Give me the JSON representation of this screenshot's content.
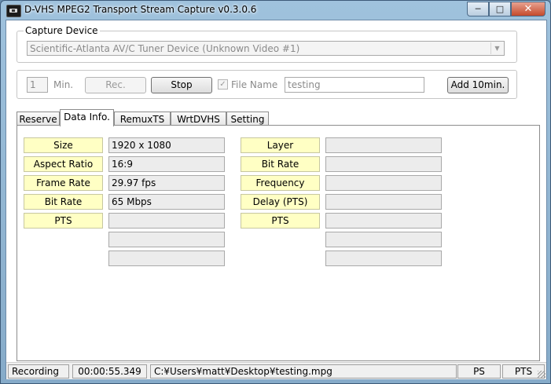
{
  "window": {
    "title": "D-VHS MPEG2 Transport Stream Capture v0.3.0.6"
  },
  "capture_device": {
    "group_label": "Capture Device",
    "selected": "Scientific-Atlanta AV/C Tuner Device (Unknown Video #1)"
  },
  "controls": {
    "minutes_value": "1",
    "minutes_label": "Min.",
    "rec_label": "Rec.",
    "stop_label": "Stop",
    "file_name_checked": true,
    "file_name_label": "File Name",
    "file_name_value": "testing",
    "add_label": "Add 10min."
  },
  "tabs": [
    {
      "label": "Reserve",
      "active": false
    },
    {
      "label": "Data Info.",
      "active": true
    },
    {
      "label": "RemuxTS",
      "active": false
    },
    {
      "label": "WrtDVHS",
      "active": false
    },
    {
      "label": "Setting",
      "active": false
    }
  ],
  "video_info": {
    "rows": [
      {
        "label": "Size",
        "value": "1920 x 1080"
      },
      {
        "label": "Aspect Ratio",
        "value": "16:9"
      },
      {
        "label": "Frame Rate",
        "value": "29.97 fps"
      },
      {
        "label": "Bit Rate",
        "value": "65 Mbps"
      },
      {
        "label": "PTS",
        "value": ""
      }
    ],
    "extra": [
      "",
      ""
    ]
  },
  "audio_info": {
    "rows": [
      {
        "label": "Layer",
        "value": ""
      },
      {
        "label": "Bit Rate",
        "value": ""
      },
      {
        "label": "Frequency",
        "value": ""
      },
      {
        "label": "Delay (PTS)",
        "value": ""
      },
      {
        "label": "PTS",
        "value": ""
      }
    ],
    "extra": [
      "",
      ""
    ]
  },
  "status": {
    "state": "Recording",
    "elapsed": "00:00:55.349",
    "path": "C:¥Users¥matt¥Desktop¥testing.mpg",
    "ps": "PS",
    "pts": "PTS"
  },
  "colors": {
    "label_bg": "#ffffc4",
    "value_bg": "#ececec",
    "close_button": "#c44a2c"
  }
}
